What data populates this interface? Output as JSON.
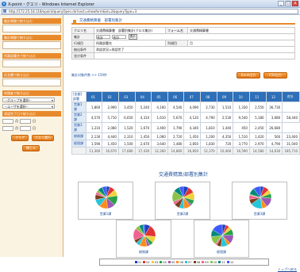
{
  "window": {
    "title": "X-point・グエリ - Windows Internet Explorer",
    "address": "http://172.25.18.118/xpoint/queryOpen.do?sect=showform&id=2&queryType=3"
  },
  "sidebar": {
    "fields": [
      {
        "label": "集計期間で絞り込む"
      },
      {
        "label": "集計期間で絞り込む"
      },
      {
        "label": "所属部署名で絞り込む"
      },
      {
        "label": "氏名欄で絞り込む"
      }
    ],
    "applicant": {
      "label": "申請者で絞り込む",
      "group_select": "--グループを選択--",
      "user_select": "--ユーザを選択--"
    },
    "date": {
      "label": "承認完了日で絞り込む",
      "month": "月",
      "day": "日"
    },
    "clear_button": "クリア",
    "display_button": "クエリ実行",
    "close_button": "閉じる"
  },
  "main": {
    "breadcrumb": "交通費精算書　部署別集計",
    "info": {
      "query_label": "クエリ名",
      "query_value": "交通費精算書　部署別集計(クロス集計)",
      "form_label": "フォーム名",
      "form_value": "交通費精算書",
      "aggregate_label": "集計",
      "aggregate_select": "合計",
      "aggregate_select2": "合計",
      "display_btn": "表示",
      "row_label": "行項目",
      "row_value": "所属部署名",
      "col_label": "列項目",
      "col_value": "月",
      "filter_label": "抽出条件",
      "filter_value": "承認状況=承認完了",
      "sort_label": "並び条件",
      "sort_value": ""
    },
    "count_text": "集計対象件数 >> 159件",
    "csv_button": "CSV出力",
    "excel_button": "Excel出力",
    "table": {
      "corner": "[金額]部署",
      "columns": [
        "01",
        "02",
        "03",
        "04",
        "05",
        "06",
        "07",
        "08",
        "09",
        "10",
        "11",
        "12",
        "合計"
      ],
      "rows": [
        {
          "label": "営業1課",
          "values": [
            "1,860",
            "2,990",
            "3,450",
            "5,240",
            "4,160",
            "4,540",
            "4,090",
            "2,730",
            "1,510",
            "1,330",
            "2,550",
            "36,730"
          ]
        },
        {
          "label": "営業2課",
          "values": [
            "4,570",
            "5,710",
            "6,650",
            "4,310",
            "1,610",
            "5,670",
            "4,120",
            "4,790",
            "2,530",
            "9,540",
            "5,180",
            "3,680",
            "58,440"
          ]
        },
        {
          "label": "営業3課",
          "values": [
            "1,210",
            "2,080",
            "1,520",
            "1,670",
            "3,400",
            "1,790",
            "4,340",
            "1,810",
            "1,440",
            "450",
            "2,450",
            "26,680"
          ]
        },
        {
          "label": "総務課",
          "values": [
            "2,130",
            "4,440",
            "2,310",
            "1,450",
            "1,060",
            "2,720",
            "1,450",
            "1,200",
            "4,350",
            "1,510",
            "1,420",
            "560",
            "23,400"
          ]
        },
        {
          "label": "経理課",
          "values": [
            "1,590",
            "1,450",
            "1,500",
            "2,670",
            "3,640",
            "1,480",
            "2,850",
            "1,830",
            "720",
            "3,770",
            "2,970",
            "4,790",
            "31,040"
          ]
        }
      ],
      "total": {
        "label": "",
        "values": [
          "11,360",
          "16,670",
          "17,680",
          "17,430",
          "12,260",
          "14,860",
          "16,850",
          "12,370",
          "10,460",
          "16,590",
          "14,580",
          "14,630",
          "185,710"
        ]
      }
    },
    "chart_title": "交通費精算/部署別集計",
    "chart_data": {
      "type": "pie",
      "title": "交通費精算/部署別集計",
      "categories": [
        "01",
        "02",
        "03",
        "04",
        "05",
        "06",
        "07",
        "08",
        "09",
        "10",
        "11",
        "12"
      ],
      "colors": [
        "#1f3fbf",
        "#e03434",
        "#f0d23a",
        "#2aa14a",
        "#9b59b6",
        "#ff8c1a",
        "#26c6da",
        "#7b3f1e",
        "#f06292",
        "#8bc34a",
        "#00897b",
        "#3d5afe"
      ],
      "series": [
        {
          "name": "営業1課",
          "values": [
            1860,
            2990,
            3450,
            5240,
            4160,
            4540,
            4090,
            2730,
            1510,
            1330,
            2550,
            2280
          ]
        },
        {
          "name": "営業2課",
          "values": [
            4570,
            5710,
            6650,
            4310,
            1610,
            5670,
            4120,
            4790,
            2530,
            9540,
            5180,
            3680
          ]
        },
        {
          "name": "営業3課",
          "values": [
            1210,
            2080,
            1520,
            1670,
            3400,
            1790,
            4340,
            1810,
            1440,
            450,
            2450,
            2520
          ]
        },
        {
          "name": "総務課",
          "values": [
            2130,
            4440,
            2310,
            1450,
            1060,
            2720,
            1450,
            1200,
            4350,
            1510,
            1420,
            560
          ]
        },
        {
          "name": "経理課",
          "values": [
            1590,
            1450,
            1500,
            2670,
            3640,
            1480,
            2850,
            1830,
            720,
            3770,
            2970,
            4790
          ]
        }
      ]
    },
    "to_top": "トップへ戻る"
  }
}
